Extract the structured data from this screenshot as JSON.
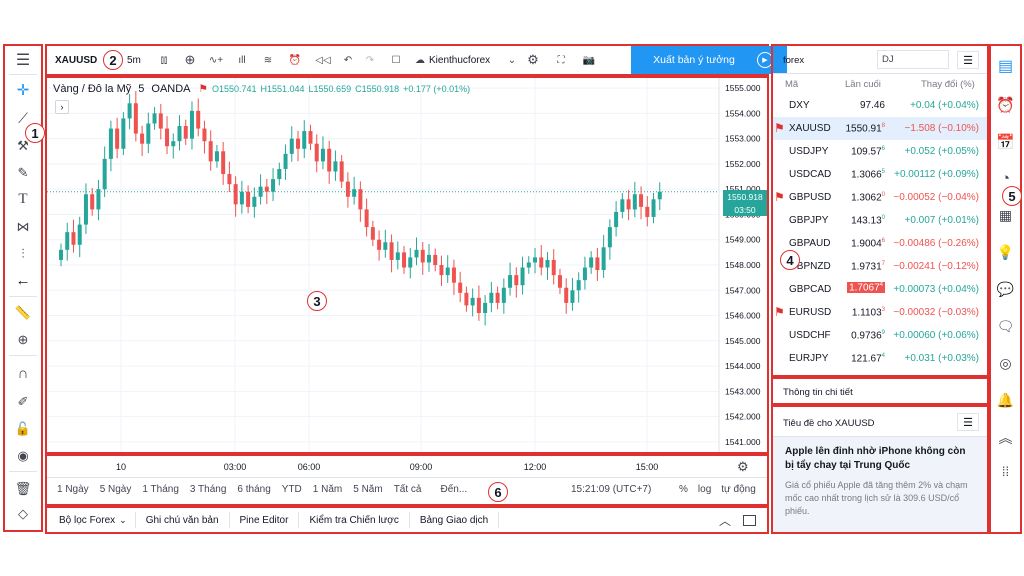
{
  "header": {
    "symbol": "XAUUSD",
    "interval": "5m",
    "broker": "Kienthucforex",
    "publish_label": "Xuất bản ý tưởng"
  },
  "legend": {
    "name": "Vàng / Đô la Mỹ",
    "interval": "5",
    "source": "OANDA",
    "o": "O1550.741",
    "h": "H1551.044",
    "l": "L1550.659",
    "c": "C1550.918",
    "chg": "+0.177 (+0.01%)"
  },
  "price_label": "1550.918",
  "countdown": "03:50",
  "chart_data": {
    "type": "candlestick",
    "y_ticks": [
      "1555.000",
      "1554.000",
      "1553.000",
      "1552.000",
      "1551.000",
      "1550.000",
      "1549.000",
      "1548.000",
      "1547.000",
      "1546.000",
      "1545.000",
      "1544.000",
      "1543.000",
      "1542.000",
      "1541.000"
    ],
    "ylim": [
      1540.6,
      1555.4
    ],
    "x_ticks": [
      "10",
      "03:00",
      "06:00",
      "09:00",
      "12:00",
      "15:00"
    ],
    "closes": [
      1548.6,
      1549.3,
      1548.8,
      1549.6,
      1550.8,
      1550.2,
      1551.0,
      1552.2,
      1553.4,
      1552.6,
      1553.8,
      1554.4,
      1553.2,
      1552.8,
      1553.6,
      1554.0,
      1553.4,
      1552.7,
      1552.9,
      1553.5,
      1553.0,
      1554.1,
      1553.4,
      1552.9,
      1552.1,
      1552.5,
      1551.6,
      1551.2,
      1550.4,
      1550.9,
      1550.3,
      1550.7,
      1551.1,
      1550.9,
      1551.4,
      1551.8,
      1552.4,
      1553.0,
      1552.6,
      1553.3,
      1552.8,
      1552.1,
      1552.6,
      1551.7,
      1552.1,
      1551.3,
      1550.7,
      1551.0,
      1550.2,
      1549.5,
      1549.0,
      1548.6,
      1548.9,
      1548.2,
      1548.5,
      1547.9,
      1548.3,
      1548.6,
      1548.1,
      1548.4,
      1548.0,
      1547.6,
      1547.9,
      1547.3,
      1546.9,
      1546.4,
      1546.7,
      1546.1,
      1546.5,
      1546.9,
      1546.5,
      1547.1,
      1547.6,
      1547.2,
      1547.9,
      1548.1,
      1548.3,
      1547.9,
      1548.2,
      1547.6,
      1547.1,
      1546.5,
      1547.0,
      1547.4,
      1547.9,
      1548.3,
      1547.8,
      1548.7,
      1549.5,
      1550.1,
      1550.6,
      1550.2,
      1550.8,
      1550.3,
      1549.9,
      1550.6,
      1550.9
    ]
  },
  "time_axis": {
    "ranges": [
      "1 Ngày",
      "5 Ngày",
      "1 Tháng",
      "3 Tháng",
      "6 tháng",
      "YTD",
      "1 Năm",
      "5 Năm",
      "Tất cả",
      "Đến..."
    ],
    "clock": "15:21:09 (UTC+7)",
    "opts": [
      "%",
      "log",
      "tự động"
    ]
  },
  "bottom_tabs": [
    "Bộ lọc Forex",
    "Ghi chú văn bản",
    "Pine Editor",
    "Kiểm tra Chiến lược",
    "Bảng Giao dịch"
  ],
  "watchlist": {
    "list_name": "forex",
    "search_value": "DJ",
    "col_symbol": "Mã",
    "col_last": "Lần cuối",
    "col_change": "Thay đổi (%)",
    "rows": [
      {
        "sym": "DXY",
        "last": "97.46",
        "chg": "+0.04 (+0.04%)",
        "dir": "pos",
        "flag": false,
        "hl": false
      },
      {
        "sym": "XAUUSD",
        "last": "1550.91",
        "sup": "8",
        "chg": "−1.508 (−0.10%)",
        "dir": "neg",
        "flag": true,
        "hl": false,
        "sel": true
      },
      {
        "sym": "USDJPY",
        "last": "109.57",
        "sup": "6",
        "chg": "+0.052 (+0.05%)",
        "dir": "pos",
        "flag": false,
        "hl": false
      },
      {
        "sym": "USDCAD",
        "last": "1.3066",
        "sup": "5",
        "chg": "+0.00112 (+0.09%)",
        "dir": "pos",
        "flag": false,
        "hl": false
      },
      {
        "sym": "GBPUSD",
        "last": "1.3062",
        "sup": "0",
        "chg": "−0.00052 (−0.04%)",
        "dir": "neg",
        "flag": true,
        "hl": false
      },
      {
        "sym": "GBPJPY",
        "last": "143.13",
        "sup": "0",
        "chg": "+0.007 (+0.01%)",
        "dir": "pos",
        "flag": false,
        "hl": false
      },
      {
        "sym": "GBPAUD",
        "last": "1.9004",
        "sup": "6",
        "chg": "−0.00486 (−0.26%)",
        "dir": "neg",
        "flag": false,
        "hl": false
      },
      {
        "sym": "GBPNZD",
        "last": "1.9731",
        "sup": "7",
        "chg": "−0.00241 (−0.12%)",
        "dir": "neg",
        "flag": false,
        "hl": false
      },
      {
        "sym": "GBPCAD",
        "last": "1.7067",
        "sup": "4",
        "chg": "+0.00073 (+0.04%)",
        "dir": "pos",
        "flag": false,
        "hl": true
      },
      {
        "sym": "EURUSD",
        "last": "1.1103",
        "sup": "3",
        "chg": "−0.00032 (−0.03%)",
        "dir": "neg",
        "flag": true,
        "hl": false
      },
      {
        "sym": "USDCHF",
        "last": "0.9736",
        "sup": "9",
        "chg": "+0.00060 (+0.06%)",
        "dir": "pos",
        "flag": false,
        "hl": false
      },
      {
        "sym": "EURJPY",
        "last": "121.67",
        "sup": "4",
        "chg": "+0.031 (+0.03%)",
        "dir": "pos",
        "flag": false,
        "hl": false
      }
    ]
  },
  "details_label": "Thông tin chi tiết",
  "news": {
    "header": "Tiêu đề cho XAUUSD",
    "title": "Apple lên đỉnh nhờ iPhone không còn bị tẩy chay tại Trung Quốc",
    "body": "Giá cổ phiếu Apple đã tăng thêm 2% và chạm mốc cao nhất trong lịch sử là 309.6 USD/cổ phiếu."
  },
  "badges": [
    "1",
    "2",
    "3",
    "4",
    "5",
    "6"
  ],
  "colors": {
    "up": "#26a69a",
    "down": "#ef5350",
    "accent": "#2196f3",
    "annot": "#e03131"
  }
}
